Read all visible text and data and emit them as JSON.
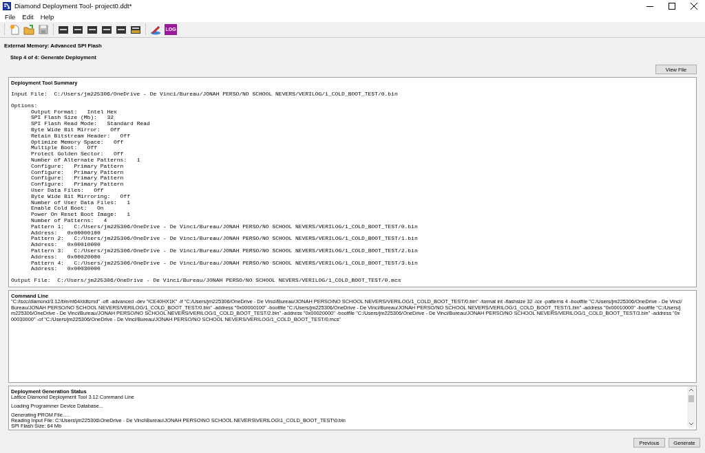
{
  "window": {
    "title": "Diamond Deployment Tool- project0.ddt*"
  },
  "menu": [
    "File",
    "Edit",
    "Help"
  ],
  "toolbar": {
    "groups": [
      [
        {
          "kind": "new"
        },
        {
          "kind": "open"
        },
        {
          "kind": "save"
        }
      ],
      [
        {
          "kind": "chip"
        },
        {
          "kind": "chip"
        },
        {
          "kind": "chip"
        },
        {
          "kind": "chip"
        },
        {
          "kind": "chip"
        },
        {
          "kind": "chip-gold"
        }
      ],
      [
        {
          "kind": "pen"
        },
        {
          "kind": "log",
          "label": "LOG"
        }
      ]
    ]
  },
  "header": {
    "memory": "External Memory:  Advanced SPI Flash",
    "step": "Step 4 of 4: Generate Deployment"
  },
  "view_file_button": "View File",
  "summary": {
    "title": "Deployment Tool Summary",
    "input_file": {
      "label": "Input File:",
      "value": "C:/Users/jm225306/OneDrive - De Vinci/Bureau/JONAH PERSO/NO SCHOOL NEVERS/VERILOG/1_COLD_BOOT_TEST/0.bin"
    },
    "options_label": "Options:",
    "options": [
      {
        "label": "Output Format:",
        "value": "Intel Hex"
      },
      {
        "label": "SPI Flash Size (Mb):",
        "value": "32"
      },
      {
        "label": "SPI Flash Read Mode:",
        "value": "Standard Read"
      },
      {
        "label": "Byte Wide Bit Mirror:",
        "value": "Off"
      },
      {
        "label": "Retain Bitstream Header:",
        "value": "Off"
      },
      {
        "label": "Optimize Memory Space:",
        "value": "Off"
      },
      {
        "label": "Multiple Boot:",
        "value": "Off"
      },
      {
        "label": "Protect Golden Sector:",
        "value": "Off"
      },
      {
        "label": "Number of Alternate Patterns:",
        "value": "1"
      },
      {
        "label": "Configure:",
        "value": "Primary Pattern"
      },
      {
        "label": "Configure:",
        "value": "Primary Pattern"
      },
      {
        "label": "Configure:",
        "value": "Primary Pattern"
      },
      {
        "label": "Configure:",
        "value": "Primary Pattern"
      },
      {
        "label": "User Data Files:",
        "value": "Off"
      },
      {
        "label": "Byte Wide Bit Mirroring:",
        "value": "Off"
      },
      {
        "label": "Number of User Data Files:",
        "value": "1"
      },
      {
        "label": "Enable Cold Boot:",
        "value": "On"
      },
      {
        "label": "Power On Reset Boot Image:",
        "value": "1"
      },
      {
        "label": "Number of Patterns:",
        "value": "4"
      },
      {
        "label": "Pattern 1:",
        "value": "C:/Users/jm225306/OneDrive - De Vinci/Bureau/JONAH PERSO/NO SCHOOL NEVERS/VERILOG/1_COLD_BOOT_TEST/0.bin"
      },
      {
        "label": "Address:",
        "value": "0x00000100"
      },
      {
        "label": "Pattern 2:",
        "value": "C:/Users/jm225306/OneDrive - De Vinci/Bureau/JONAH PERSO/NO SCHOOL NEVERS/VERILOG/1_COLD_BOOT_TEST/1.bin"
      },
      {
        "label": "Address:",
        "value": "0x00010000"
      },
      {
        "label": "Pattern 3:",
        "value": "C:/Users/jm225306/OneDrive - De Vinci/Bureau/JONAH PERSO/NO SCHOOL NEVERS/VERILOG/1_COLD_BOOT_TEST/2.bin"
      },
      {
        "label": "Address:",
        "value": "0x00020000"
      },
      {
        "label": "Pattern 4:",
        "value": "C:/Users/jm225306/OneDrive - De Vinci/Bureau/JONAH PERSO/NO SCHOOL NEVERS/VERILOG/1_COLD_BOOT_TEST/3.bin"
      },
      {
        "label": "Address:",
        "value": "0x00030000"
      }
    ],
    "output_file": {
      "label": "Output File:",
      "value": "C:/Users/jm225306/OneDrive - De Vinci/Bureau/JONAH PERSO/NO SCHOOL NEVERS/VERILOG/1_COLD_BOOT_TEST/0.mcs"
    }
  },
  "command_line": {
    "title": "Command Line",
    "text": "\"C:/lscc/diamond/3.12/bin/nt64/ddtcmd\" -oft -advanced -dev \"iCE40HX1K\" -if \"C:/Users/jm225306/OneDrive - De Vinci/Bureau/JONAH PERSO/NO SCHOOL NEVERS/VERILOG/1_COLD_BOOT_TEST/0.bin\" -format int -flashsize 32 -ice -patterns 4 -bootfile \"C:/Users/jm225306/OneDrive - De Vinci/Bureau/JONAH PERSO/NO SCHOOL NEVERS/VERILOG/1_COLD_BOOT_TEST/0.bin\" -address \"0x00000100\" -bootfile \"C:/Users/jm225306/OneDrive - De Vinci/Bureau/JONAH PERSO/NO SCHOOL NEVERS/VERILOG/1_COLD_BOOT_TEST/1.bin\" -address \"0x00010000\" -bootfile \"C:/Users/jm225306/OneDrive - De Vinci/Bureau/JONAH PERSO/NO SCHOOL NEVERS/VERILOG/1_COLD_BOOT_TEST/2.bin\" -address \"0x00020000\" -bootfile \"C:/Users/jm225306/OneDrive - De Vinci/Bureau/JONAH PERSO/NO SCHOOL NEVERS/VERILOG/1_COLD_BOOT_TEST/3.bin\" -address \"0x00030000\" -of \"C:/Users/jm225306/OneDrive - De Vinci/Bureau/JONAH PERSO/NO SCHOOL NEVERS/VERILOG/1_COLD_BOOT_TEST/0.mcs\""
  },
  "status": {
    "title": "Deployment Generation Status",
    "paragraphs": [
      [
        "Lattice Diamond Deployment Tool 3.12 Command Line"
      ],
      [
        "Loading Programmer Device Database..."
      ],
      [
        "Generating PROM File.....",
        "Reading Input File: C:\\Users\\jm225306\\OneDrive - De Vinci\\Bureau\\JONAH PERSO\\NO SCHOOL NEVERS\\VERILOG\\1_COLD_BOOT_TEST\\0.bin",
        "SPI Flash Size: 64 Mb"
      ]
    ]
  },
  "buttons": [
    "Previous",
    "Generate"
  ]
}
